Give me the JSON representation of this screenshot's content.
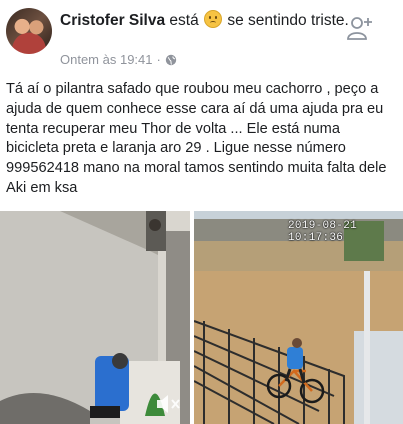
{
  "post": {
    "author": "Cristofer Silva",
    "feeling_prefix": "está",
    "feeling_text": "se sentindo triste.",
    "timestamp": "Ontem às 19:41",
    "separator": "·",
    "body": "Tá aí o pilantra safado que roubou meu cachorro , peço a ajuda de quem conhece esse cara aí dá uma ajuda pra eu tenta recuperar meu Thor de volta ... Ele está numa bicicleta preta e laranja aro 29 . Ligue nesse número 999562418 mano na moral tamos sentindo muita falta dele Aki em ksa"
  },
  "icons": {
    "feeling": "sad-face-icon",
    "privacy": "globe-icon",
    "add_friend": "add-friend-icon",
    "mute": "mute-icon"
  },
  "media": {
    "video_timestamp": "2019-08-21 10:17:36"
  }
}
